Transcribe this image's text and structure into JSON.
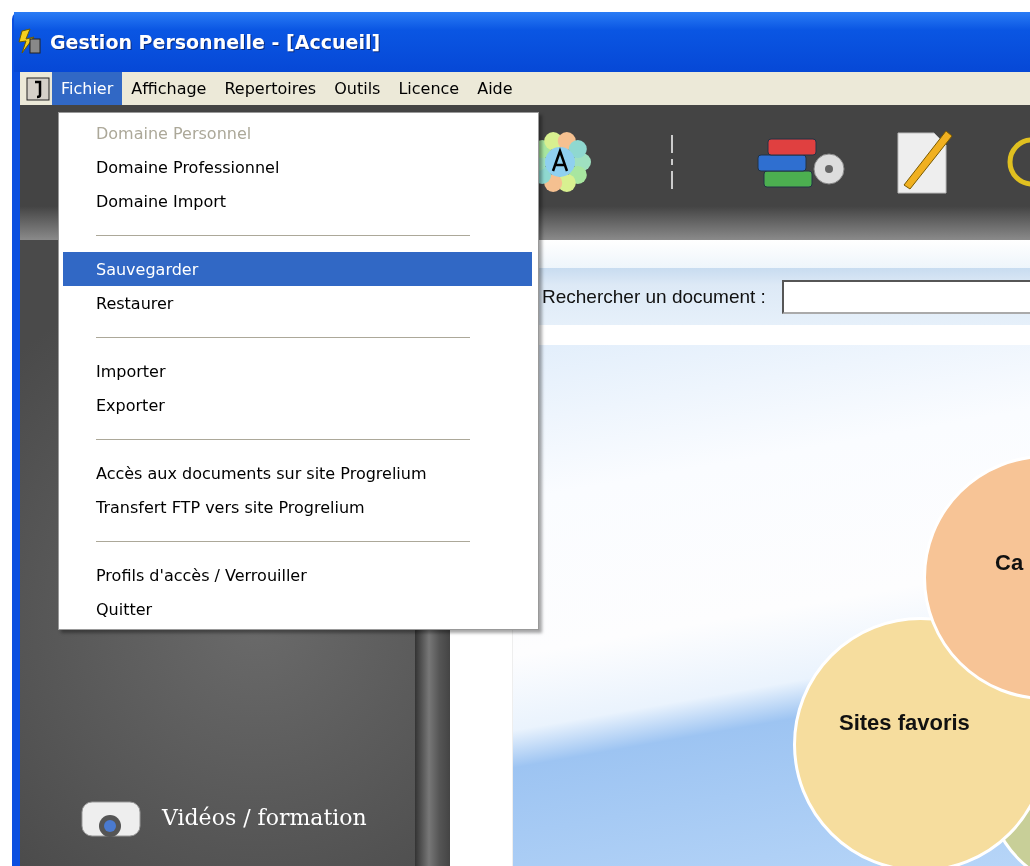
{
  "window": {
    "title": "Gestion Personnelle - [Accueil]"
  },
  "menu_bar": [
    {
      "label": "Fichier",
      "selected": true
    },
    {
      "label": "Affichage",
      "selected": false
    },
    {
      "label": "Repertoires",
      "selected": false
    },
    {
      "label": "Outils",
      "selected": false
    },
    {
      "label": "Licence",
      "selected": false
    },
    {
      "label": "Aide",
      "selected": false
    }
  ],
  "file_menu": {
    "groups": [
      [
        {
          "label": "Domaine Personnel",
          "disabled": true,
          "selected": false
        },
        {
          "label": "Domaine Professionnel",
          "disabled": false,
          "selected": false
        },
        {
          "label": "Domaine Import",
          "disabled": false,
          "selected": false
        }
      ],
      [
        {
          "label": "Sauvegarder",
          "disabled": false,
          "selected": true
        },
        {
          "label": "Restaurer",
          "disabled": false,
          "selected": false
        }
      ],
      [
        {
          "label": "Importer",
          "disabled": false,
          "selected": false
        },
        {
          "label": "Exporter",
          "disabled": false,
          "selected": false
        }
      ],
      [
        {
          "label": "Accès aux documents sur site Progrelium",
          "disabled": false,
          "selected": false
        },
        {
          "label": "Transfert FTP vers site Progrelium",
          "disabled": false,
          "selected": false
        }
      ],
      [
        {
          "label": "Profils d'accès / Verrouiller",
          "disabled": false,
          "selected": false
        },
        {
          "label": "Quitter",
          "disabled": false,
          "selected": false
        }
      ]
    ]
  },
  "search": {
    "label": "Rechercher un document :"
  },
  "sidebar": {
    "items": [
      {
        "label": "Vidéos / formation"
      }
    ]
  },
  "bubbles": [
    {
      "label": "Ca",
      "color": "#f7c496"
    },
    {
      "label": "Sites favoris",
      "color": "#f6dd9e"
    }
  ]
}
